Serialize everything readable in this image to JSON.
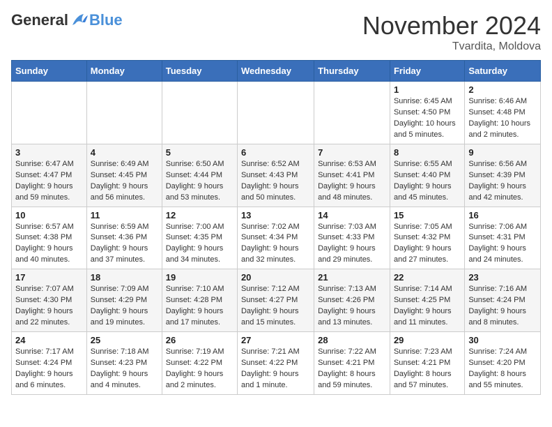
{
  "header": {
    "logo_general": "General",
    "logo_blue": "Blue",
    "month_title": "November 2024",
    "location": "Tvardita, Moldova"
  },
  "weekdays": [
    "Sunday",
    "Monday",
    "Tuesday",
    "Wednesday",
    "Thursday",
    "Friday",
    "Saturday"
  ],
  "weeks": [
    [
      {
        "day": "",
        "info": ""
      },
      {
        "day": "",
        "info": ""
      },
      {
        "day": "",
        "info": ""
      },
      {
        "day": "",
        "info": ""
      },
      {
        "day": "",
        "info": ""
      },
      {
        "day": "1",
        "info": "Sunrise: 6:45 AM\nSunset: 4:50 PM\nDaylight: 10 hours and 5 minutes."
      },
      {
        "day": "2",
        "info": "Sunrise: 6:46 AM\nSunset: 4:48 PM\nDaylight: 10 hours and 2 minutes."
      }
    ],
    [
      {
        "day": "3",
        "info": "Sunrise: 6:47 AM\nSunset: 4:47 PM\nDaylight: 9 hours and 59 minutes."
      },
      {
        "day": "4",
        "info": "Sunrise: 6:49 AM\nSunset: 4:45 PM\nDaylight: 9 hours and 56 minutes."
      },
      {
        "day": "5",
        "info": "Sunrise: 6:50 AM\nSunset: 4:44 PM\nDaylight: 9 hours and 53 minutes."
      },
      {
        "day": "6",
        "info": "Sunrise: 6:52 AM\nSunset: 4:43 PM\nDaylight: 9 hours and 50 minutes."
      },
      {
        "day": "7",
        "info": "Sunrise: 6:53 AM\nSunset: 4:41 PM\nDaylight: 9 hours and 48 minutes."
      },
      {
        "day": "8",
        "info": "Sunrise: 6:55 AM\nSunset: 4:40 PM\nDaylight: 9 hours and 45 minutes."
      },
      {
        "day": "9",
        "info": "Sunrise: 6:56 AM\nSunset: 4:39 PM\nDaylight: 9 hours and 42 minutes."
      }
    ],
    [
      {
        "day": "10",
        "info": "Sunrise: 6:57 AM\nSunset: 4:38 PM\nDaylight: 9 hours and 40 minutes."
      },
      {
        "day": "11",
        "info": "Sunrise: 6:59 AM\nSunset: 4:36 PM\nDaylight: 9 hours and 37 minutes."
      },
      {
        "day": "12",
        "info": "Sunrise: 7:00 AM\nSunset: 4:35 PM\nDaylight: 9 hours and 34 minutes."
      },
      {
        "day": "13",
        "info": "Sunrise: 7:02 AM\nSunset: 4:34 PM\nDaylight: 9 hours and 32 minutes."
      },
      {
        "day": "14",
        "info": "Sunrise: 7:03 AM\nSunset: 4:33 PM\nDaylight: 9 hours and 29 minutes."
      },
      {
        "day": "15",
        "info": "Sunrise: 7:05 AM\nSunset: 4:32 PM\nDaylight: 9 hours and 27 minutes."
      },
      {
        "day": "16",
        "info": "Sunrise: 7:06 AM\nSunset: 4:31 PM\nDaylight: 9 hours and 24 minutes."
      }
    ],
    [
      {
        "day": "17",
        "info": "Sunrise: 7:07 AM\nSunset: 4:30 PM\nDaylight: 9 hours and 22 minutes."
      },
      {
        "day": "18",
        "info": "Sunrise: 7:09 AM\nSunset: 4:29 PM\nDaylight: 9 hours and 19 minutes."
      },
      {
        "day": "19",
        "info": "Sunrise: 7:10 AM\nSunset: 4:28 PM\nDaylight: 9 hours and 17 minutes."
      },
      {
        "day": "20",
        "info": "Sunrise: 7:12 AM\nSunset: 4:27 PM\nDaylight: 9 hours and 15 minutes."
      },
      {
        "day": "21",
        "info": "Sunrise: 7:13 AM\nSunset: 4:26 PM\nDaylight: 9 hours and 13 minutes."
      },
      {
        "day": "22",
        "info": "Sunrise: 7:14 AM\nSunset: 4:25 PM\nDaylight: 9 hours and 11 minutes."
      },
      {
        "day": "23",
        "info": "Sunrise: 7:16 AM\nSunset: 4:24 PM\nDaylight: 9 hours and 8 minutes."
      }
    ],
    [
      {
        "day": "24",
        "info": "Sunrise: 7:17 AM\nSunset: 4:24 PM\nDaylight: 9 hours and 6 minutes."
      },
      {
        "day": "25",
        "info": "Sunrise: 7:18 AM\nSunset: 4:23 PM\nDaylight: 9 hours and 4 minutes."
      },
      {
        "day": "26",
        "info": "Sunrise: 7:19 AM\nSunset: 4:22 PM\nDaylight: 9 hours and 2 minutes."
      },
      {
        "day": "27",
        "info": "Sunrise: 7:21 AM\nSunset: 4:22 PM\nDaylight: 9 hours and 1 minute."
      },
      {
        "day": "28",
        "info": "Sunrise: 7:22 AM\nSunset: 4:21 PM\nDaylight: 8 hours and 59 minutes."
      },
      {
        "day": "29",
        "info": "Sunrise: 7:23 AM\nSunset: 4:21 PM\nDaylight: 8 hours and 57 minutes."
      },
      {
        "day": "30",
        "info": "Sunrise: 7:24 AM\nSunset: 4:20 PM\nDaylight: 8 hours and 55 minutes."
      }
    ]
  ]
}
